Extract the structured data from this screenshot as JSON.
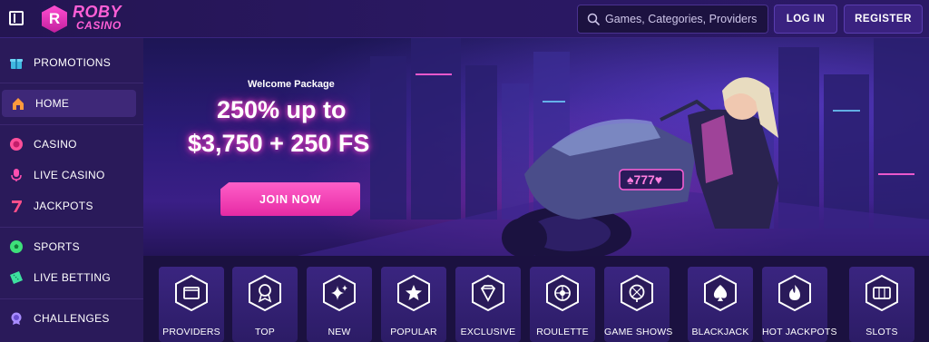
{
  "header": {
    "logo_word1": "ROBY",
    "logo_word2": "CASINO",
    "search_placeholder": "Games, Categories, Providers",
    "login_label": "LOG IN",
    "register_label": "REGISTER"
  },
  "sidebar": {
    "items": [
      {
        "label": "PROMOTIONS",
        "icon": "gift-icon"
      },
      {
        "label": "HOME",
        "icon": "home-icon",
        "active": true
      },
      {
        "label": "CASINO",
        "icon": "chip-icon"
      },
      {
        "label": "LIVE CASINO",
        "icon": "microphone-icon"
      },
      {
        "label": "JACKPOTS",
        "icon": "seven-icon"
      },
      {
        "label": "SPORTS",
        "icon": "soccer-ball-icon"
      },
      {
        "label": "LIVE BETTING",
        "icon": "ticket-icon"
      },
      {
        "label": "CHALLENGES",
        "icon": "medal-icon"
      }
    ]
  },
  "hero": {
    "subtitle": "Welcome Package",
    "title_line1": "250% up to",
    "title_line2": "$3,750 + 250 FS",
    "cta_label": "JOIN NOW",
    "bike_sign": "♠777♥"
  },
  "categories": [
    {
      "label": "PROVIDERS",
      "icon": "folder-icon"
    },
    {
      "label": "TOP",
      "icon": "award-icon"
    },
    {
      "label": "NEW",
      "icon": "sparkle-icon"
    },
    {
      "label": "POPULAR",
      "icon": "star-icon"
    },
    {
      "label": "EXCLUSIVE",
      "icon": "diamond-icon"
    },
    {
      "label": "ROULETTE",
      "icon": "roulette-icon"
    },
    {
      "label": "GAME SHOWS",
      "icon": "wheel-icon"
    },
    {
      "label": "BLACKJACK",
      "icon": "spade-icon"
    },
    {
      "label": "HOT JACKPOTS",
      "icon": "flame-icon"
    },
    {
      "label": "SLOTS",
      "icon": "slot-icon"
    }
  ],
  "colors": {
    "accent_pink": "#ff4fd1",
    "sidebar_bg": "#2a1a5a",
    "topbar_bg": "#241552",
    "button_bg": "#3a2280"
  }
}
